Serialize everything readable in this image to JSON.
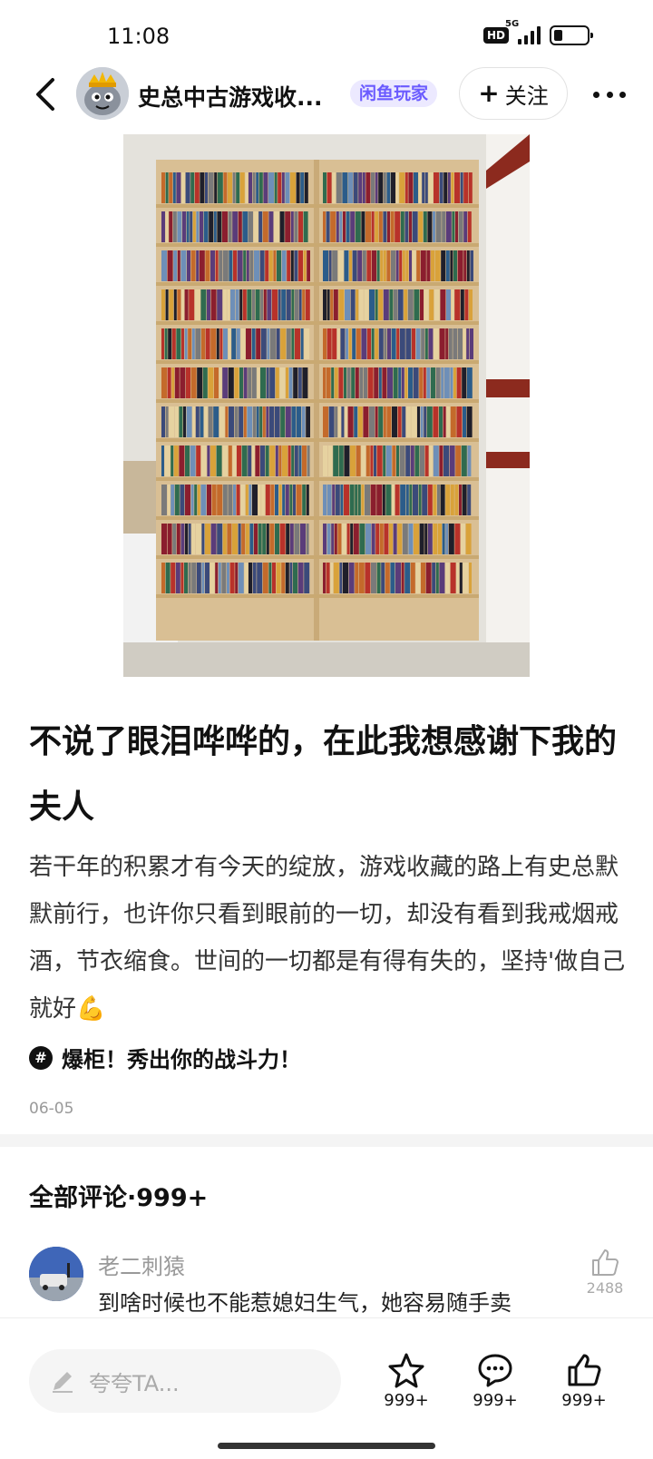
{
  "status_bar": {
    "time": "11:08",
    "hd_label": "HD",
    "network_label": "5G",
    "battery_level": 0.25,
    "icons": [
      "hd-icon",
      "signal-icon",
      "battery-icon"
    ]
  },
  "header": {
    "back_icon": "chevron-left-icon",
    "user_name": "史总中古游戏收...",
    "user_badge": "闲鱼玩家",
    "follow_plus": "+",
    "follow_label": "关注",
    "more_icon": "more-dots-icon",
    "badge_color": "#6b5bff"
  },
  "media": {
    "description_icon": "photo-bookshelf",
    "pager": {
      "count": 5,
      "active_index": 1
    }
  },
  "post": {
    "title": "不说了眼泪哗哗的，在此我想感谢下我的夫人",
    "body": "若干年的积累才有今天的绽放，游戏收藏的路上有史总默默前行，也许你只看到眼前的一切，却没有看到我戒烟戒酒，节衣缩食。世间的一切都是有得有失的，坚持'做自己就好💪",
    "topic_hash": "#",
    "topic": "爆柜！秀出你的战斗力！",
    "date": "06-05"
  },
  "comments": {
    "title": "全部评论·999+",
    "items": [
      {
        "name": "老二刺猿",
        "text": "到啥时候也不能惹媳妇生气，她容易随手卖",
        "likes": "2488"
      }
    ]
  },
  "bottom_bar": {
    "input_placeholder": "夸夸TA...",
    "star_count": "999+",
    "comment_count": "999+",
    "like_count": "999+"
  }
}
